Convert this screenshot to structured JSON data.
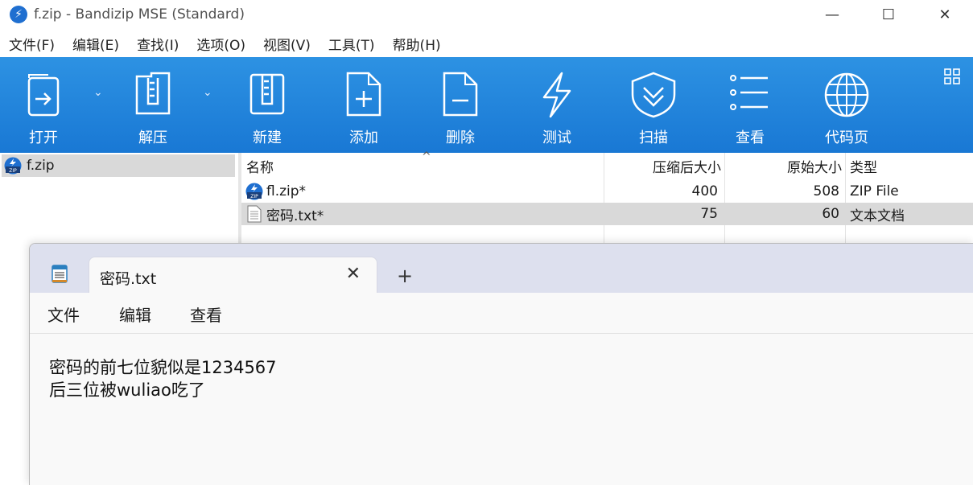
{
  "window": {
    "title": "f.zip - Bandizip MSE (Standard)",
    "minimize_icon": "—",
    "maximize_icon": "☐",
    "close_icon": "✕"
  },
  "menu": [
    "文件(F)",
    "编辑(E)",
    "查找(I)",
    "选项(O)",
    "视图(V)",
    "工具(T)",
    "帮助(H)"
  ],
  "toolbar": {
    "open": "打开",
    "extract": "解压",
    "new": "新建",
    "add": "添加",
    "delete": "删除",
    "test": "测试",
    "scan": "扫描",
    "view": "查看",
    "codepage": "代码页"
  },
  "tree": {
    "root": "f.zip"
  },
  "file_list": {
    "columns": {
      "name": "名称",
      "packed": "压缩后大小",
      "original": "原始大小",
      "type": "类型"
    },
    "sort_indicator": "^",
    "rows": [
      {
        "name": "fl.zip*",
        "packed": "400",
        "original": "508",
        "type": "ZIP File"
      },
      {
        "name": "密码.txt*",
        "packed": "75",
        "original": "60",
        "type": "文本文档"
      }
    ]
  },
  "notepad": {
    "tab_title": "密码.txt",
    "tab_close": "✕",
    "new_tab": "+",
    "menu": {
      "file": "文件",
      "edit": "编辑",
      "view": "查看"
    },
    "lines": [
      "密码的前七位貌似是1234567",
      "后三位被wuliao吃了"
    ]
  },
  "colors": {
    "toolbar": "#1e84dc",
    "selection": "#d9d9d9",
    "notepad_tabstrip": "#dde0ee"
  }
}
